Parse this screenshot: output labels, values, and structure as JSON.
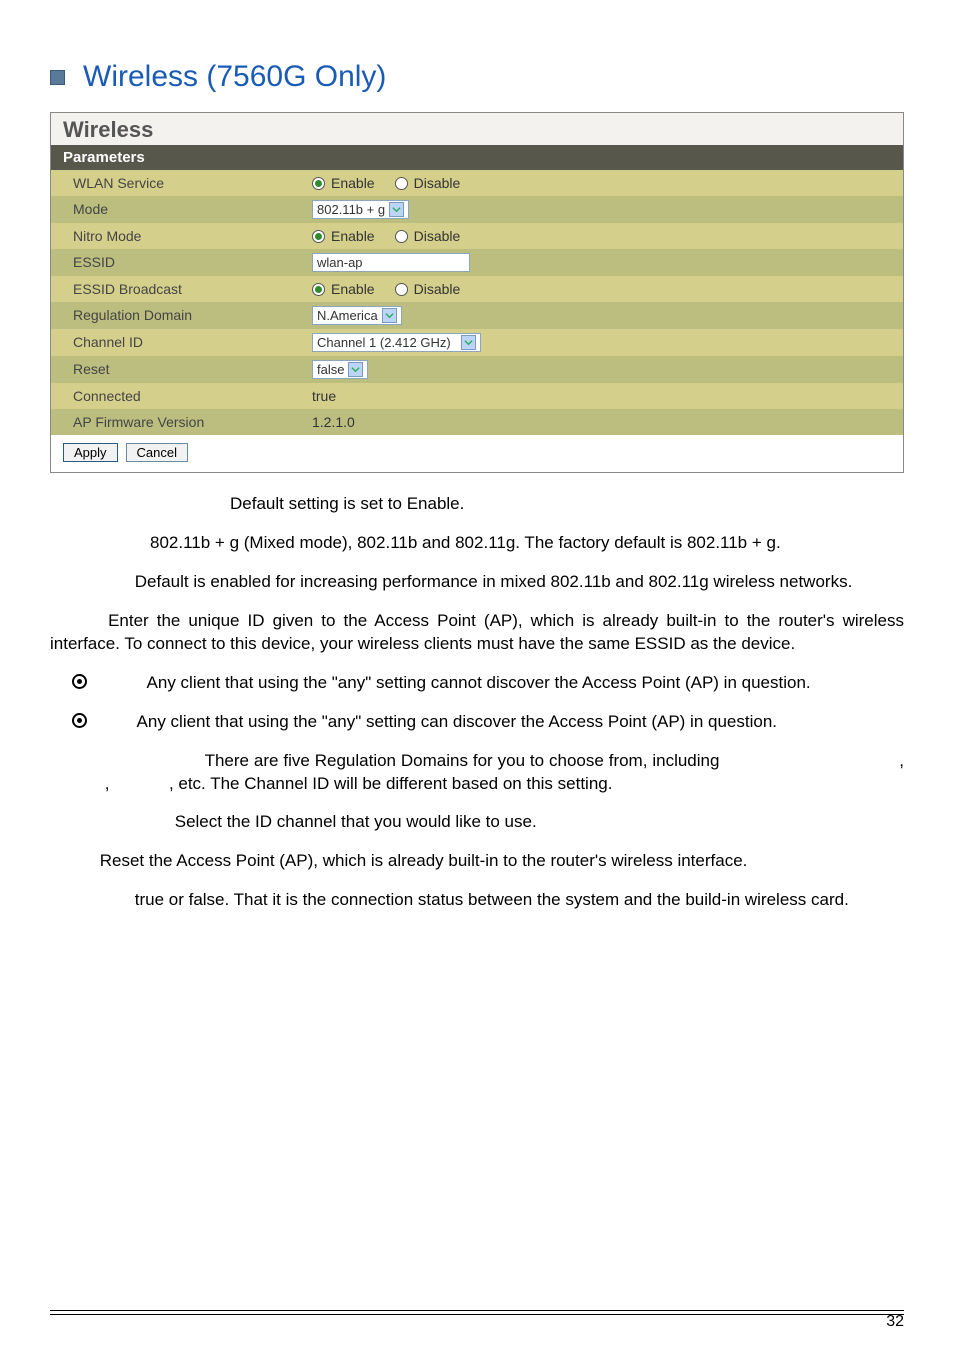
{
  "section": {
    "title": "Wireless (7560G Only)"
  },
  "widget": {
    "title": "Wireless",
    "params_header": "Parameters",
    "rows": {
      "wlan": {
        "label": "WLAN Service",
        "enable": "Enable",
        "disable": "Disable"
      },
      "mode": {
        "label": "Mode",
        "value": "802.11b + g"
      },
      "nitro": {
        "label": "Nitro Mode",
        "enable": "Enable",
        "disable": "Disable"
      },
      "essid": {
        "label": "ESSID",
        "value": "wlan-ap"
      },
      "essid_bcast": {
        "label": "ESSID Broadcast",
        "enable": "Enable",
        "disable": "Disable"
      },
      "regdom": {
        "label": "Regulation Domain",
        "value": "N.America"
      },
      "channel": {
        "label": "Channel ID",
        "value": "Channel 1 (2.412 GHz)"
      },
      "reset": {
        "label": "Reset",
        "value": "false"
      },
      "connected": {
        "label": "Connected",
        "value": "true"
      },
      "apfw": {
        "label": "AP Firmware Version",
        "value": "1.2.1.0"
      }
    },
    "buttons": {
      "apply": "Apply",
      "cancel": "Cancel"
    }
  },
  "paragraphs": {
    "p1": " Default setting is set to Enable.",
    "p2": " 802.11b + g (Mixed mode), 802.11b and 802.11g. The factory default is 802.11b + g.",
    "p3": " Default is enabled for increasing performance in mixed 802.11b and 802.11g wireless networks.",
    "p4": " Enter the unique ID given to the Access Point (AP), which is already built-in to the router's wireless interface. To connect to this device, your wireless clients must have the same ESSID as the device.",
    "p5": " Any client that using the \"any\" setting cannot discover the Access Point (AP) in question.",
    "p6": " Any client that using the \"any\" setting can discover the Access Point (AP) in question.",
    "p7a": " There are five Regulation Domains for you to choose from, including ",
    "p7b": ", etc. The Channel ID will be different based on this setting.",
    "p7_sep1": ",",
    "p7_sep2": ",",
    "p8": " Select the ID channel that you would like to use.",
    "p9": " Reset the Access Point (AP), which is already built-in to the router's wireless interface.",
    "p10": " true or false. That it is the connection status between the system and the build-in wireless card."
  },
  "page_number": "32"
}
